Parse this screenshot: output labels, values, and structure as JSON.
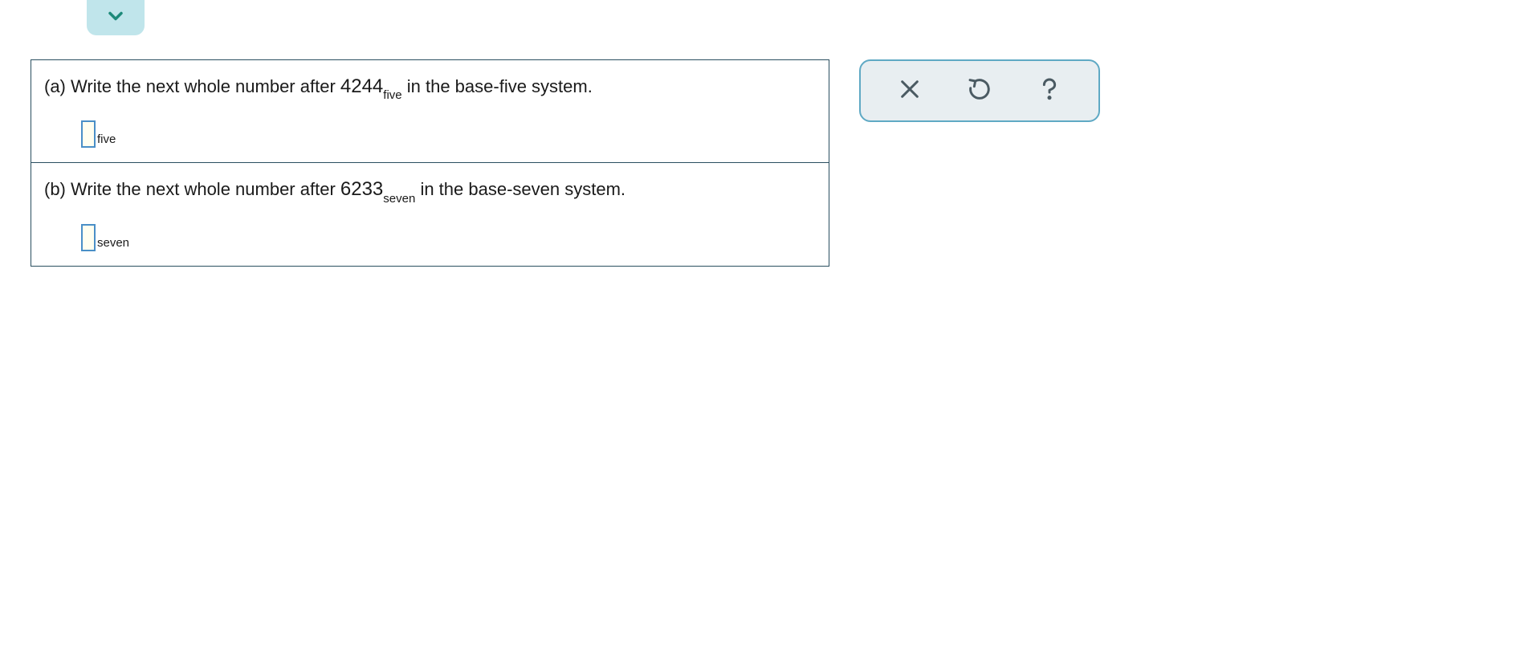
{
  "question": {
    "part_a": {
      "label": "(a)",
      "text_before": "Write the next whole number after ",
      "number": "4244",
      "number_sub": "five",
      "text_after": " in the base-five system.",
      "answer_sub": "five"
    },
    "part_b": {
      "label": "(b)",
      "text_before": "Write the next whole number after ",
      "number": "6233",
      "number_sub": "seven",
      "text_after": " in the base-seven system.",
      "answer_sub": "seven"
    }
  },
  "icons": {
    "chevron": "chevron-down",
    "clear": "x",
    "reset": "undo",
    "help": "question"
  },
  "colors": {
    "chevron_bg": "#c0e5eb",
    "chevron_stroke": "#1d8a7a",
    "border": "#2a4f60",
    "input_border": "#4a8fc7",
    "input_bg": "#fffef0",
    "toolbox_bg": "#e8eef1",
    "toolbox_border": "#5fa9c4",
    "tool_icon": "#4a5a62"
  }
}
